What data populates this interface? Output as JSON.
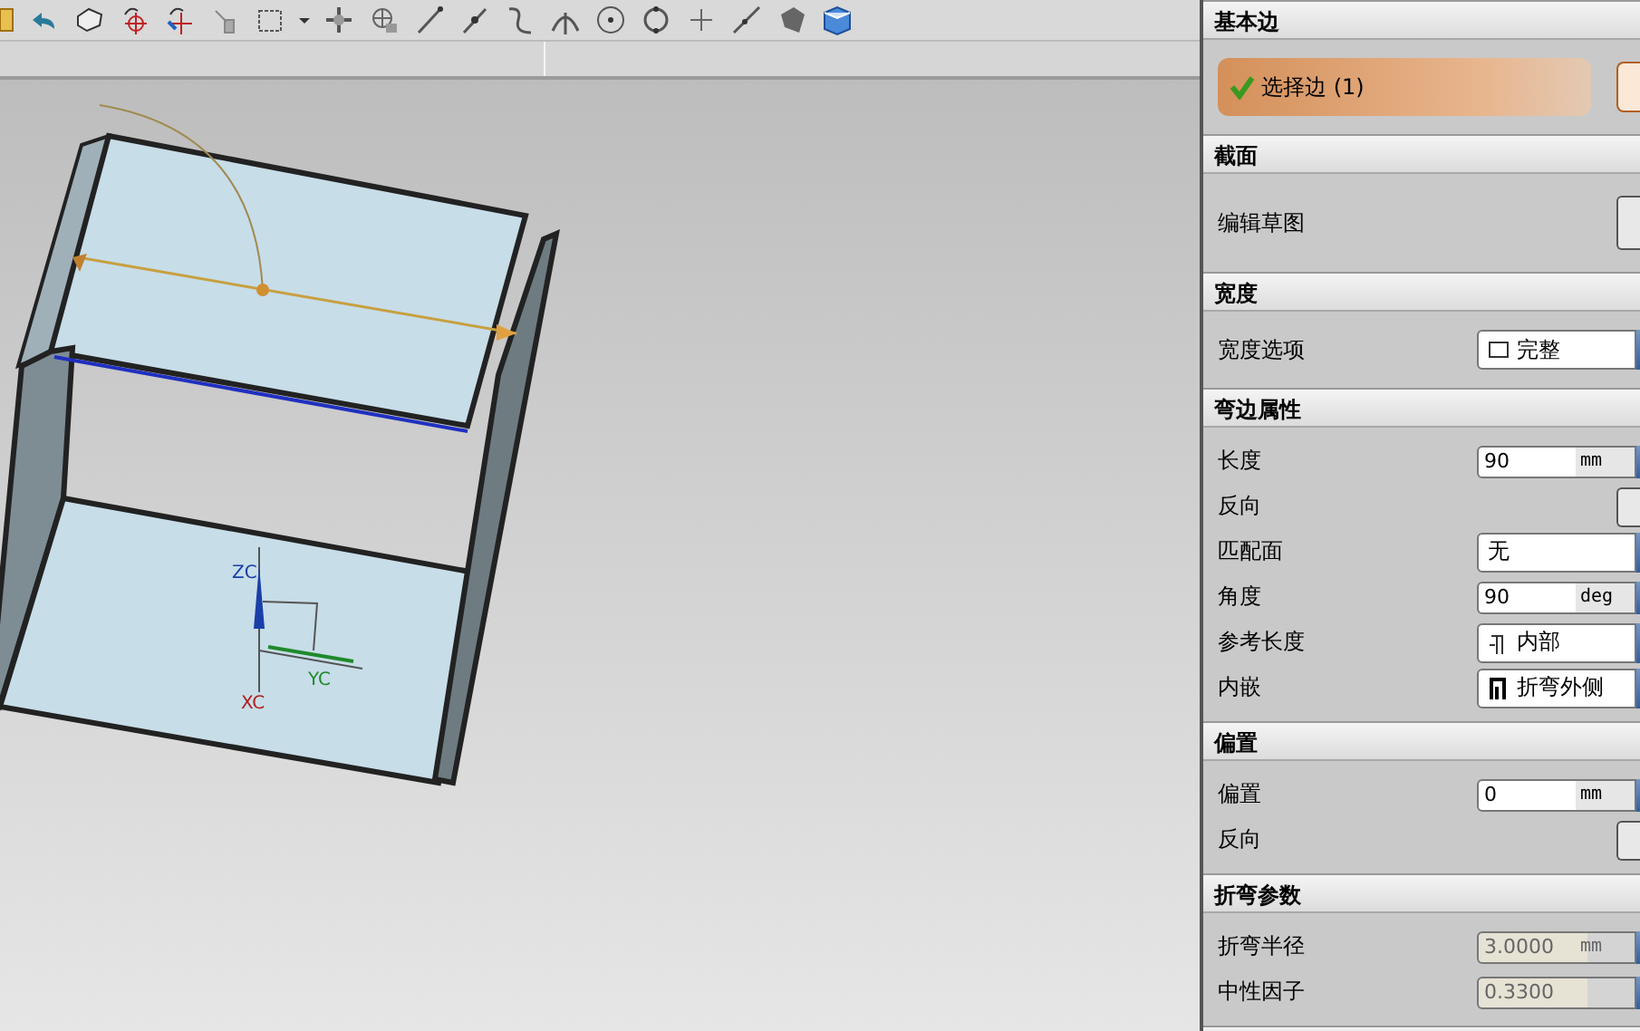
{
  "panel": {
    "sections": [
      {
        "title": "基本边",
        "rows": [
          {
            "kind": "selection",
            "label": "选择边 (1)",
            "completed": true
          }
        ]
      },
      {
        "title": "截面",
        "rows": [
          {
            "kind": "sketch",
            "label": "编辑草图"
          }
        ]
      },
      {
        "title": "宽度",
        "rows": [
          {
            "kind": "select",
            "label": "宽度选项",
            "value": "完整"
          }
        ]
      },
      {
        "title": "弯边属性",
        "rows": [
          {
            "kind": "input",
            "label": "长度",
            "value": "90",
            "unit": "mm",
            "disabled": false
          },
          {
            "kind": "flip",
            "label": "反向"
          },
          {
            "kind": "select",
            "label": "匹配面",
            "value": "无"
          },
          {
            "kind": "input",
            "label": "角度",
            "value": "90",
            "unit": "deg",
            "disabled": false
          },
          {
            "kind": "select",
            "label": "参考长度",
            "value": "内部"
          },
          {
            "kind": "select",
            "label": "内嵌",
            "value": "折弯外侧"
          }
        ]
      },
      {
        "title": "偏置",
        "rows": [
          {
            "kind": "input",
            "label": "偏置",
            "value": "0",
            "unit": "mm",
            "disabled": false
          },
          {
            "kind": "flip",
            "label": "反向"
          }
        ]
      },
      {
        "title": "折弯参数",
        "rows": [
          {
            "kind": "input",
            "label": "折弯半径",
            "value": "3.0000",
            "unit": "mm",
            "disabled": true
          },
          {
            "kind": "input",
            "label": "中性因子",
            "value": "0.3300",
            "unit": "",
            "disabled": true
          }
        ]
      }
    ]
  },
  "viewport": {
    "axes": [
      {
        "kind": "z",
        "label": "ZC"
      },
      {
        "kind": "y",
        "label": "YC"
      },
      {
        "kind": "x",
        "label": "XC"
      }
    ]
  }
}
